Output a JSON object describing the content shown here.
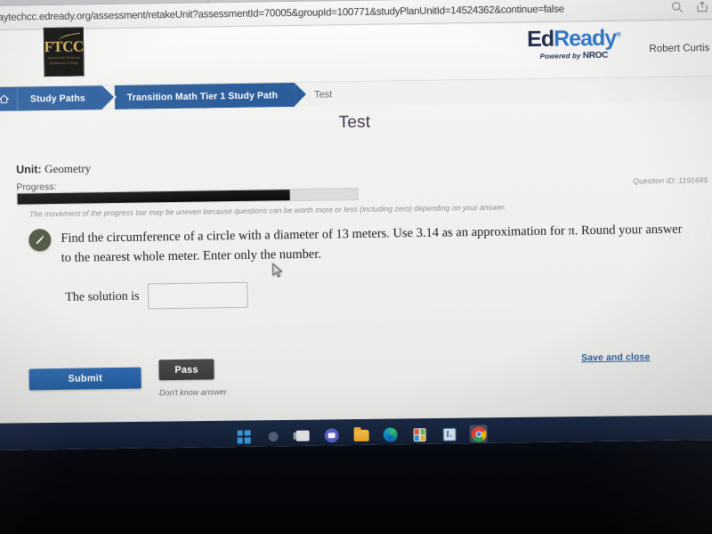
{
  "browser": {
    "url": "faytechcc.edready.org/assessment/retakeUnit?assessmentId=70005&groupId=100771&studyPlanUnitId=14524362&continue=false",
    "icons": {
      "zoom": "search-icon",
      "share": "share-icon"
    }
  },
  "header": {
    "school_logo": {
      "name": "FTCC",
      "line1": "Fayetteville Technical",
      "line2": "Community College"
    },
    "product_logo": {
      "part1": "Ed",
      "part2": "Ready",
      "trademark": "®",
      "powered_by": "Powered by ",
      "powered_brand": "NROC"
    },
    "user_name": "Robert Curtis"
  },
  "breadcrumb": {
    "home_icon": "home-icon",
    "items": [
      {
        "label": "Study Paths",
        "active": true
      },
      {
        "label": "Transition Math Tier 1 Study Path",
        "active": true
      },
      {
        "label": "Test",
        "active": false
      }
    ]
  },
  "page": {
    "title": "Test",
    "unit_label": "Unit:",
    "unit_value": "Geometry",
    "progress_label": "Progress:",
    "progress_percent": 80,
    "question_id": "Question ID: 1191695",
    "disclaimer": "The movement of the progress bar may be uneven because questions can be worth more or less (including zero) depending on your answer."
  },
  "question": {
    "icon": "pencil-icon",
    "text_line1": "Find the circumference of a circle with a diameter of 13 meters. Use 3.14 as an approximation for π. Round your answer to the nearest",
    "text_line2": "whole meter. Enter only the number.",
    "answer_label": "The solution is",
    "answer_value": "",
    "answer_placeholder": ""
  },
  "actions": {
    "submit_label": "Submit",
    "pass_label": "Pass",
    "pass_caption": "Don't know answer",
    "save_close_label": "Save and close"
  },
  "taskbar": {
    "items": [
      {
        "name": "start-button",
        "label": "Start"
      },
      {
        "name": "search-button",
        "label": "Search"
      },
      {
        "name": "task-view-button",
        "label": "Task View"
      },
      {
        "name": "microsoft-teams-button",
        "label": "Microsoft Teams"
      },
      {
        "name": "file-explorer-button",
        "label": "File Explorer"
      },
      {
        "name": "microsoft-edge-button",
        "label": "Microsoft Edge"
      },
      {
        "name": "microsoft-store-button",
        "label": "Microsoft Store"
      },
      {
        "name": "lockdown-app-button",
        "label": "L"
      },
      {
        "name": "google-chrome-button",
        "label": "Google Chrome"
      }
    ]
  },
  "colors": {
    "brand_blue": "#2c5f9e",
    "edready_dark": "#1c2b4a",
    "edready_blue": "#2e77c8",
    "pass_gray": "#3b3b3b",
    "question_icon_green": "#4e5640",
    "taskbar": "#16233b"
  }
}
